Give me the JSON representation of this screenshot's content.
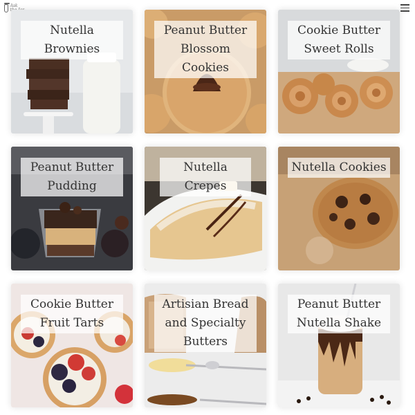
{
  "header": {
    "logo_text": "Ask the Jar",
    "logo_icon": "jar-icon",
    "menu_icon": "hamburger-menu-icon"
  },
  "recipes": [
    {
      "title": "Nutella Brownies"
    },
    {
      "title": "Peanut Butter Blossom Cookies"
    },
    {
      "title": "Cookie Butter Sweet Rolls"
    },
    {
      "title": "Peanut Butter Pudding"
    },
    {
      "title": "Nutella Crepes"
    },
    {
      "title": "Nutella Cookies"
    },
    {
      "title": "Cookie Butter Fruit Tarts"
    },
    {
      "title": "Artisian Bread and Specialty Butters"
    },
    {
      "title": "Peanut Butter Nutella Shake"
    }
  ]
}
